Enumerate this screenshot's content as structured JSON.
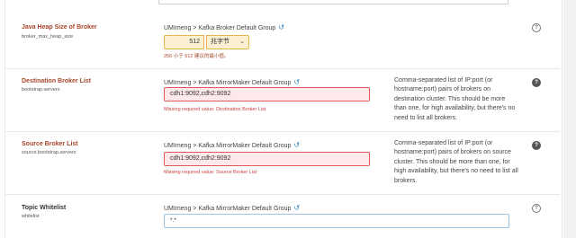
{
  "properties": [
    {
      "name": "Java Heap Size of Broker",
      "key": "broker_max_heap_size",
      "scope": "UMImeng > Kafka Broker Default Group",
      "value": "512",
      "unit": "兆字节",
      "hint": "256 小于 512 建议的最小值。"
    },
    {
      "name": "Destination Broker List",
      "key": "bootstrap.servers",
      "scope": "UMImeng > Kafka MirrorMaker Default Group",
      "value": "cdh1:9092,cdh2:9092",
      "error": "Missing required value: Destination Broker List",
      "description": [
        "Comma-separated list of IP:port (or",
        "hostname:port) pairs of brokers on",
        "destination cluster. This should be more",
        "than one, for high availability, but there's no",
        "need to list all brokers."
      ]
    },
    {
      "name": "Source Broker List",
      "key": "source.bootstrap.servers",
      "scope": "UMImeng > Kafka MirrorMaker Default Group",
      "value": "cdh1:9092,cdh2:9092",
      "error": "Missing required value: Source Broker List",
      "description": [
        "Comma-separated list of IP:port (or",
        "hostname:port) pairs of brokers on source",
        "cluster. This should be more than one, for",
        "high availability, but there's no need to list all",
        "brokers."
      ]
    },
    {
      "name": "Topic Whitelist",
      "key": "whitelist",
      "scope": "UMImeng > Kafka MirrorMaker Default Group",
      "value": "*.*"
    }
  ],
  "icons": {
    "undo": "undo-arrow-icon",
    "help": "question-circle-icon",
    "dropdown": "chevron-down-icon"
  },
  "glyphs": {
    "undo": "↺",
    "help": "?",
    "chevron": "⌄"
  },
  "colors": {
    "required_label": "#a5472a",
    "error": "#c83e3e",
    "warning_field": "#fcf0d3",
    "link": "#2d7fb8"
  }
}
